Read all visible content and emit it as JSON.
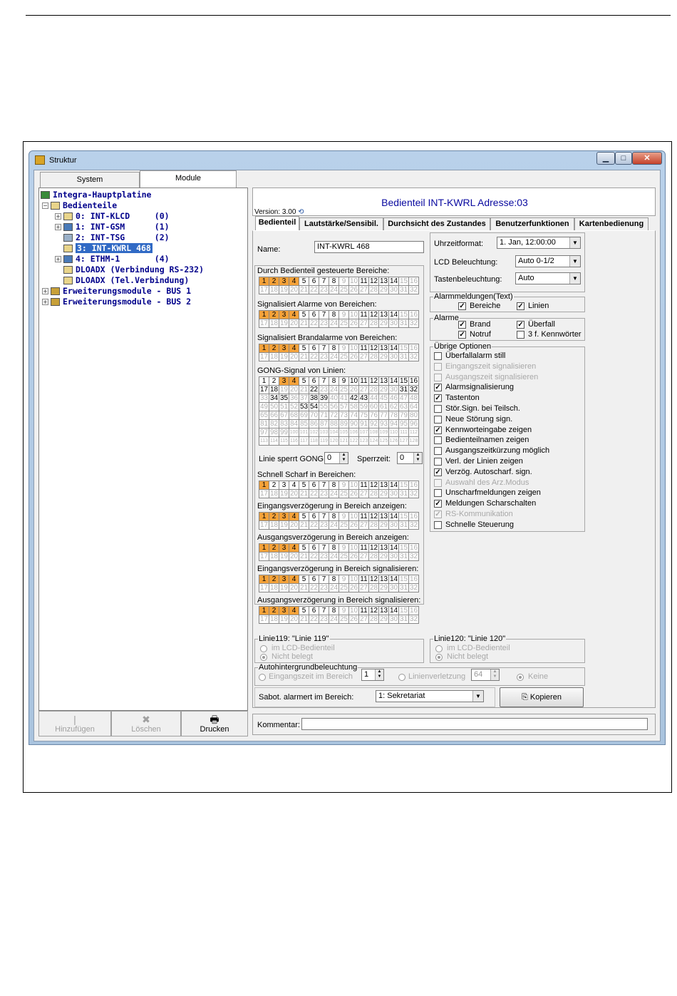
{
  "window": {
    "title": "Struktur"
  },
  "left_tabs": [
    "System",
    "Module"
  ],
  "tree": [
    {
      "label": "Integra-Hauptplatine"
    },
    {
      "label": "Bedienteile"
    },
    {
      "label": "0: INT-KLCD     (0)"
    },
    {
      "label": "1: INT-GSM      (1)"
    },
    {
      "label": "2: INT-TSG      (2)"
    },
    {
      "label": "3: INT-KWRL 468"
    },
    {
      "label": "4: ETHM-1       (4)"
    },
    {
      "label": "DLOADX (Verbindung RS-232)"
    },
    {
      "label": "DLOADX (Tel.Verbindung)"
    },
    {
      "label": "Erweiterungsmodule - BUS 1"
    },
    {
      "label": "Erweiterungsmodule - BUS 2"
    }
  ],
  "left_buttons": [
    "Hinzufügen",
    "Löschen",
    "Drucken"
  ],
  "header": {
    "title": "Bedienteil INT-KWRL Adresse:03",
    "version": "Version: 3.00"
  },
  "detail_tabs": [
    "Bedienteil",
    "Lautstärke/Sensibil.",
    "Durchsicht des Zustandes",
    "Benutzerfunktionen",
    "Kartenbedienung"
  ],
  "name": {
    "label": "Name:",
    "value": "INT-KWRL 468"
  },
  "grids": [
    {
      "title": "Durch Bedienteil gesteuerte Bereiche:",
      "on": [
        1,
        2,
        3,
        4
      ],
      "active": [
        5,
        6,
        7,
        8,
        11,
        12,
        13,
        14
      ]
    },
    {
      "title": "Signalisiert Alarme von Bereichen:",
      "on": [
        1,
        2,
        3,
        4
      ],
      "active": [
        5,
        6,
        7,
        8,
        11,
        12,
        13,
        14
      ]
    },
    {
      "title": "Signalisiert Brandalarme von Bereichen:",
      "on": [
        1,
        2,
        3,
        4
      ],
      "active": [
        5,
        6,
        7,
        8,
        11,
        12,
        13,
        14
      ]
    },
    {
      "title": "Schnell Scharf in Bereichen:",
      "on": [
        1
      ],
      "active": [
        2,
        3,
        4,
        5,
        6,
        7,
        8,
        11,
        12,
        13,
        14
      ]
    },
    {
      "title": "Eingangsverzögerung in Bereich anzeigen:",
      "on": [
        1,
        2,
        3,
        4
      ],
      "active": [
        5,
        6,
        7,
        8,
        11,
        12,
        13,
        14
      ]
    },
    {
      "title": "Ausgangsverzögerung in Bereich anzeigen:",
      "on": [
        1,
        2,
        3,
        4
      ],
      "active": [
        5,
        6,
        7,
        8,
        11,
        12,
        13,
        14
      ]
    },
    {
      "title": "Eingangsverzögerung in Bereich signalisieren:",
      "on": [
        1,
        2,
        3,
        4
      ],
      "active": [
        5,
        6,
        7,
        8,
        11,
        12,
        13,
        14
      ]
    },
    {
      "title": "Ausgangsverzögerung in Bereich signalisieren:",
      "on": [
        1,
        2,
        3,
        4
      ],
      "active": [
        5,
        6,
        7,
        8,
        11,
        12,
        13,
        14
      ]
    }
  ],
  "gong": {
    "title": "GONG-Signal von Linien:",
    "on": [
      3,
      4
    ],
    "active": [
      1,
      2,
      5,
      6,
      7,
      8,
      9,
      10,
      11,
      12,
      13,
      14,
      15,
      16,
      17,
      18,
      22,
      31,
      32,
      34,
      35,
      38,
      39,
      42,
      43,
      53,
      54
    ]
  },
  "linie_sperrt": {
    "label": "Linie sperrt GONG:",
    "value": "0",
    "sperrzeit_label": "Sperrzeit:",
    "sperrzeit_value": "0"
  },
  "uhrzeit": {
    "label": "Uhrzeitformat:",
    "value": "1. Jan, 12:00:00"
  },
  "lcd": {
    "label": "LCD Beleuchtung:",
    "value": "Auto 0-1/2"
  },
  "tasten": {
    "label": "Tastenbeleuchtung:",
    "value": "Auto"
  },
  "alarmmeldungen": {
    "title": "Alarmmeldungen(Text)",
    "items": [
      {
        "label": "Bereiche",
        "checked": true
      },
      {
        "label": "Linien",
        "checked": true
      }
    ]
  },
  "alarme": {
    "title": "Alarme",
    "items": [
      {
        "label": "Brand",
        "checked": true
      },
      {
        "label": "Überfall",
        "checked": true
      },
      {
        "label": "Notruf",
        "checked": true
      },
      {
        "label": "3 f. Kennwörter",
        "checked": false
      }
    ]
  },
  "options": {
    "title": "Übrige Optionen",
    "items": [
      {
        "label": "Überfallalarm still",
        "checked": false,
        "disabled": false
      },
      {
        "label": "Eingangszeit signalisieren",
        "checked": false,
        "disabled": true
      },
      {
        "label": "Ausgangszeit signalisieren",
        "checked": false,
        "disabled": true
      },
      {
        "label": "Alarmsignalisierung",
        "checked": true,
        "disabled": false
      },
      {
        "label": "Tastenton",
        "checked": true,
        "disabled": false
      },
      {
        "label": "Stör.Sign. bei Teilsch.",
        "checked": false,
        "disabled": false
      },
      {
        "label": "Neue Störung sign.",
        "checked": false,
        "disabled": false
      },
      {
        "label": "Kennworteingabe zeigen",
        "checked": true,
        "disabled": false
      },
      {
        "label": "Bedienteilnamen zeigen",
        "checked": false,
        "disabled": false
      },
      {
        "label": "Ausgangszeitkürzung möglich",
        "checked": false,
        "disabled": false
      },
      {
        "label": "Verl. der Linien zeigen",
        "checked": false,
        "disabled": false
      },
      {
        "label": "Verzög. Autoscharf. sign.",
        "checked": true,
        "disabled": false
      },
      {
        "label": "Auswahl des Arz.Modus",
        "checked": false,
        "disabled": true
      },
      {
        "label": "Unscharfmeldungen zeigen",
        "checked": false,
        "disabled": false
      },
      {
        "label": "Meldungen Scharschalten",
        "checked": true,
        "disabled": false
      },
      {
        "label": "RS-Kommunikation",
        "checked": true,
        "disabled": true
      },
      {
        "label": "Schnelle Steuerung",
        "checked": false,
        "disabled": false
      }
    ]
  },
  "linie119": {
    "title": "Linie119: \"Linie 119\"",
    "opt1": "im LCD-Bedienteil",
    "opt2": "Nicht belegt"
  },
  "linie120": {
    "title": "Linie120: \"Linie 120\"",
    "opt1": "im LCD-Bedienteil",
    "opt2": "Nicht belegt"
  },
  "autohg": {
    "title": "Autohintergrundbeleuchtung",
    "opt1": "Eingangszeit im Bereich",
    "val1": "1",
    "opt2": "Linienverletzung",
    "val2": "64",
    "opt3": "Keine"
  },
  "sabot": {
    "label": "Sabot. alarmert im Bereich:",
    "value": "1: Sekretariat"
  },
  "kopieren": "Kopieren",
  "kommentar": {
    "label": "Kommentar:",
    "value": ""
  }
}
